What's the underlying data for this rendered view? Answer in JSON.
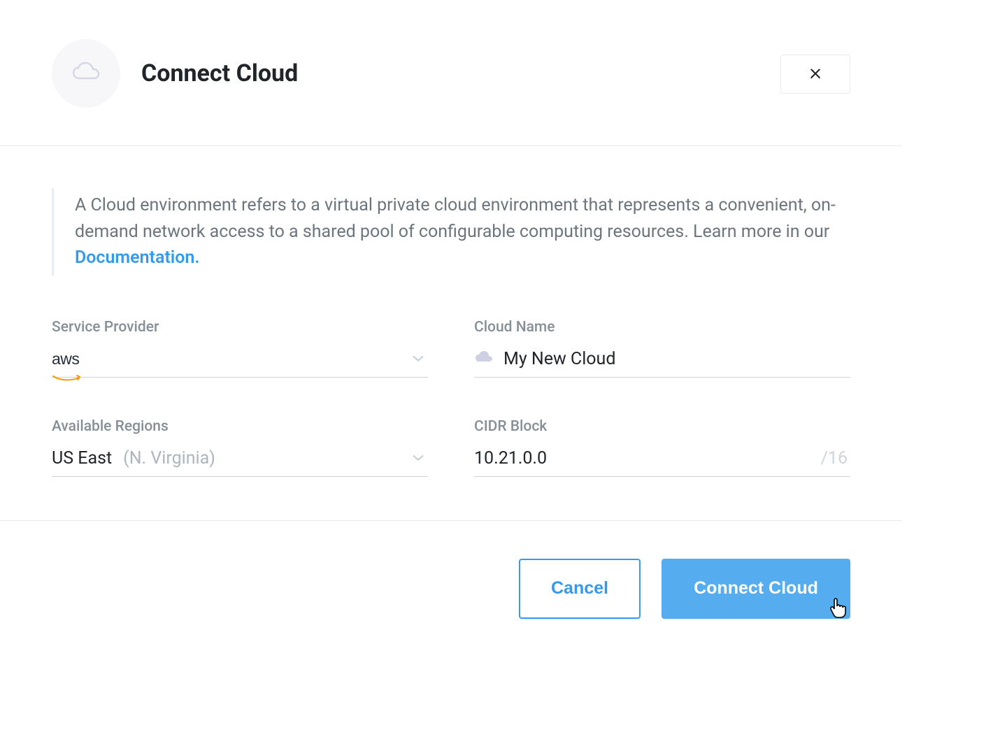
{
  "header": {
    "title": "Connect Cloud"
  },
  "info": {
    "text": "A Cloud environment refers to a virtual private cloud environment that represents a convenient, on-demand network access to a shared pool of configurable computing resources. Learn more in our ",
    "link": "Documentation."
  },
  "form": {
    "service_provider": {
      "label": "Service Provider",
      "value": "aws"
    },
    "cloud_name": {
      "label": "Cloud Name",
      "value": "My New Cloud"
    },
    "regions": {
      "label": "Available Regions",
      "value": "US East",
      "detail": "(N. Virginia)"
    },
    "cidr": {
      "label": "CIDR Block",
      "value": "10.21.0.0",
      "suffix": "/16"
    }
  },
  "footer": {
    "cancel": "Cancel",
    "submit": "Connect Cloud"
  }
}
